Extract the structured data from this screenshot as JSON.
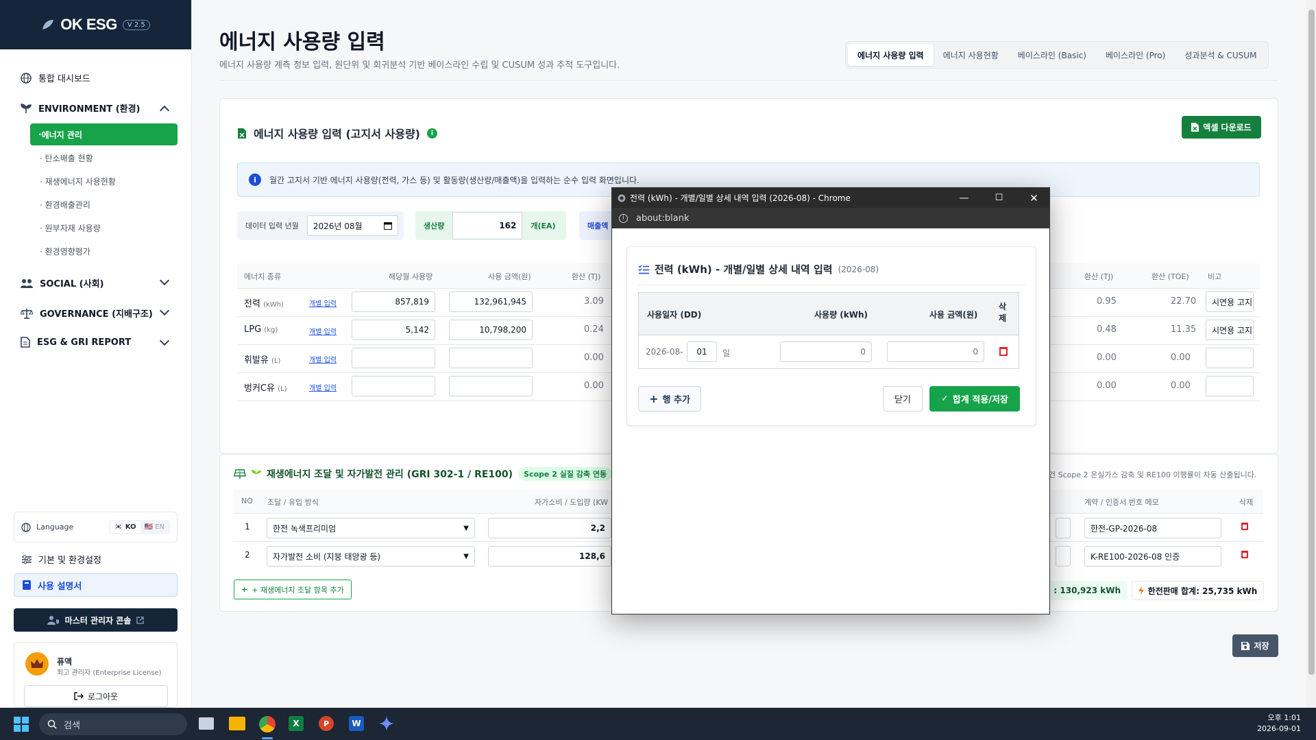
{
  "brand": {
    "logo": "OK ESG",
    "version": "V 2.5"
  },
  "sidebar": {
    "dashboard": "통합 대시보드",
    "environment": "ENVIRONMENT (환경)",
    "env_items": [
      "에너지 관리",
      "탄소배출 현황",
      "재생에너지 사용현황",
      "환경배출관리",
      "원부자재 사용량",
      "환경영향평가"
    ],
    "social": "SOCIAL (사회)",
    "governance": "GOVERNANCE (지배구조)",
    "report": "ESG & GRI REPORT",
    "language_label": "Language",
    "lang_ko": "KO",
    "lang_en": "EN",
    "settings": "기본 및 환경설정",
    "manual": "사용 설명서",
    "master_console": "마스터 관리자 콘솔",
    "user_name": "퓨액",
    "user_role": "최고 관리자 (Enterprise License)",
    "logout": "로그아웃"
  },
  "header": {
    "title": "에너지 사용량 입력",
    "subtitle": "에너지 사용량 계측 정보 입력, 원단위 및 회귀분석 기반 베이스라인 수립 및 CUSUM 성과 추적 도구입니다.",
    "tabs": [
      "에너지 사용량 입력",
      "에너지 사용현황",
      "베이스라인 (Basic)",
      "베이스라인 (Pro)",
      "성과분석 & CUSUM"
    ]
  },
  "card": {
    "title": "에너지 사용량 입력 (고지서 사용량)",
    "excel_button": "엑셀 다운로드",
    "info": "월간 고지서 기반 에너지 사용량(전력, 가스 등) 및 활동량(생산량/매출액)을 입력하는 순수 입력 화면입니다.",
    "period_label": "데이터 입력 년월",
    "period_value": "2026년 08월",
    "production_label": "생산량",
    "production_value": "162",
    "production_unit": "개(EA)",
    "sales_label": "매출액",
    "columns": [
      "에너지 종류",
      "해당월 사용량",
      "사용 금액(원)",
      "환산 (TJ)"
    ],
    "right_columns": [
      "환산 (TJ)",
      "환산 (TOE)",
      "비고"
    ],
    "detail_link": "개별 입력",
    "rows": [
      {
        "name": "전력",
        "unit": "(kWh)",
        "usage": "857,819",
        "amount": "132,961,945",
        "tj": "3.09",
        "tj2": "0.95",
        "toe": "22.70",
        "note": "시연용 고지"
      },
      {
        "name": "LPG",
        "unit": "(kg)",
        "usage": "5,142",
        "amount": "10,798,200",
        "tj": "0.24",
        "tj2": "0.48",
        "toe": "11.35",
        "note": "시연용 고지"
      },
      {
        "name": "휘발유",
        "unit": "(L)",
        "usage": "",
        "amount": "",
        "tj": "0.00",
        "tj2": "0.00",
        "toe": "0.00",
        "note": ""
      },
      {
        "name": "벙커C유",
        "unit": "(L)",
        "usage": "",
        "amount": "",
        "tj": "0.00",
        "tj2": "0.00",
        "toe": "0.00",
        "note": ""
      }
    ]
  },
  "renew": {
    "title": "재생에너지 조달 및 자가발전 관리 (GRI 302-1 / RE100)",
    "badge": "Scope 2 실질 감축 연동",
    "right_note": "건 Scope 2 온실가스 감축 및 RE100 이행률이 자동 산출됩니다.",
    "columns": [
      "NO",
      "조달 / 유입 방식",
      "자가소비 / 도입량 (KW",
      "계약 / 인증서 번호 메모",
      "삭제"
    ],
    "rows": [
      {
        "no": "1",
        "method": "한전 녹색프리미엄",
        "qty": "2,2",
        "memo": "한전-GP-2026-08"
      },
      {
        "no": "2",
        "method": "자가발전 소비 (지붕 태양광 등)",
        "qty": "128,6",
        "memo": "K-RE100-2026-08 인증"
      }
    ],
    "add_button": "+ 재생에너지 조달 항목 추가",
    "sum1": ": 130,923 kWh",
    "sum2": "한전판매 합계: 25,735 kWh",
    "save": "저장"
  },
  "popup": {
    "window_title": "전력 (kWh) - 개별/일별 상세 내역 입력 (2026-08) - Chrome",
    "address": "about:blank",
    "heading": "전력 (kWh) - 개별/일별 상세 내역 입력",
    "heading_period": "(2026-08)",
    "col_date": "사용일자 (DD)",
    "col_usage": "사용량 (kWh)",
    "col_amount": "사용 금액(원)",
    "col_delete": "삭제",
    "date_prefix": "2026-08-",
    "day": "01",
    "day_suffix": "일",
    "usage": "0",
    "amount": "0",
    "add_row": "행 추가",
    "close": "닫기",
    "apply": "합계 적용/저장"
  },
  "taskbar": {
    "search": "검색",
    "time": "오후 1:01",
    "date": "2026-09-01"
  }
}
